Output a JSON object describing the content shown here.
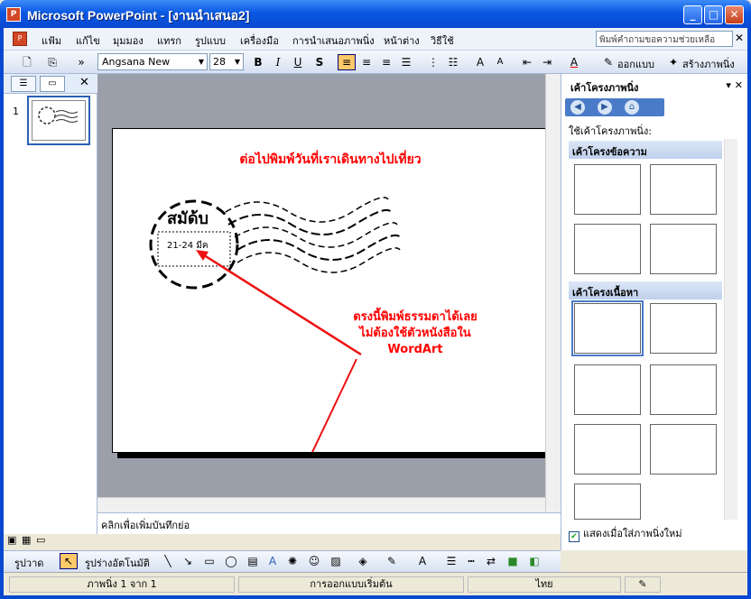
{
  "window": {
    "title": "Microsoft PowerPoint - [งานนำเสนอ2]",
    "min": "_",
    "max": "□",
    "close": "✕"
  },
  "menu": {
    "items": [
      "แฟ้ม",
      "แก้ไข",
      "มุมมอง",
      "แทรก",
      "รูปแบบ",
      "เครื่องมือ",
      "การนำเสนอภาพนิ่ง",
      "หน้าต่าง",
      "วิธีใช้"
    ],
    "help_placeholder": "พิมพ์คำถามขอความช่วยเหลือ"
  },
  "toolbar": {
    "font": "Angsana New",
    "size": "28",
    "bold": "B",
    "italic": "I",
    "underline": "U",
    "shadow": "S",
    "design": "ออกแบบ",
    "new_slide": "สร้างภาพนิ่ง"
  },
  "slides_pane": {
    "slide_number": "1"
  },
  "slide": {
    "title": "ต่อไปพิมพ์วันที่เราเดินทางไปเที่ยว",
    "stamp_word": "สมัด้บ",
    "stamp_date": "21-24 มีค",
    "callout": [
      "ตรงนี้พิมพ์ธรรมดาได้เลย",
      "ไม่ต้องใช้ตัวหนังสือใน",
      "WordArt"
    ]
  },
  "notes": {
    "placeholder": "คลิกเพื่อเพิ่มบันทึกย่อ"
  },
  "task_pane": {
    "title": "เค้าโครงภาพนิ่ง",
    "apply_label": "ใช้เค้าโครงภาพนิ่ง:",
    "section_text": "เค้าโครงข้อความ",
    "section_content": "เค้าโครงเนื้อหา",
    "show_on_insert": "แสดงเมื่อใส่ภาพนิ่งใหม่"
  },
  "drawing": {
    "draw": "รูปวาด",
    "autoshapes": "รูปร่างอัตโนมัติ"
  },
  "status": {
    "slide": "ภาพนิ่ง 1 จาก 1",
    "design": "การออกแบบเริ่มต้น",
    "language": "ไทย"
  }
}
